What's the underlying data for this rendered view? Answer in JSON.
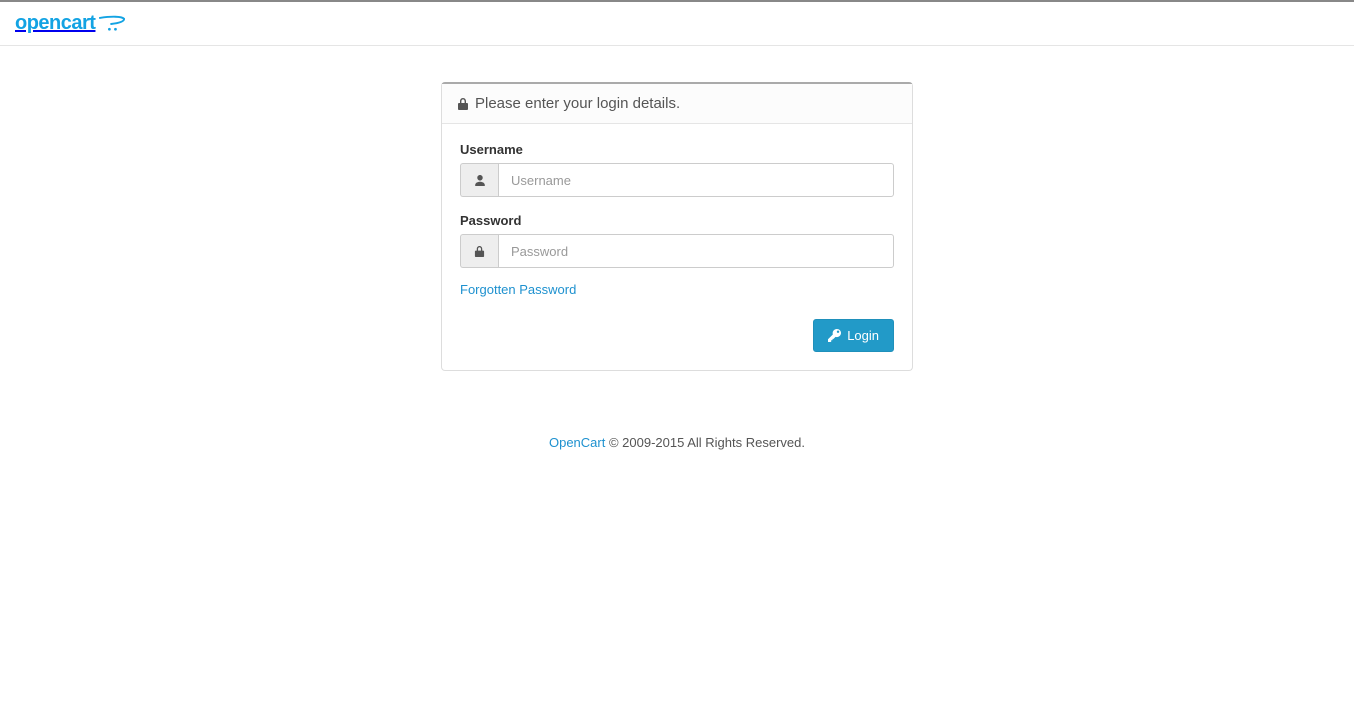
{
  "header": {
    "brand_text": "opencart"
  },
  "panel": {
    "heading": "Please enter your login details."
  },
  "form": {
    "username_label": "Username",
    "username_placeholder": "Username",
    "username_value": "",
    "password_label": "Password",
    "password_placeholder": "Password",
    "password_value": "",
    "forgot_text": "Forgotten Password",
    "login_button": "Login"
  },
  "footer": {
    "link_text": "OpenCart",
    "rest": " © 2009-2015 All Rights Reserved."
  }
}
